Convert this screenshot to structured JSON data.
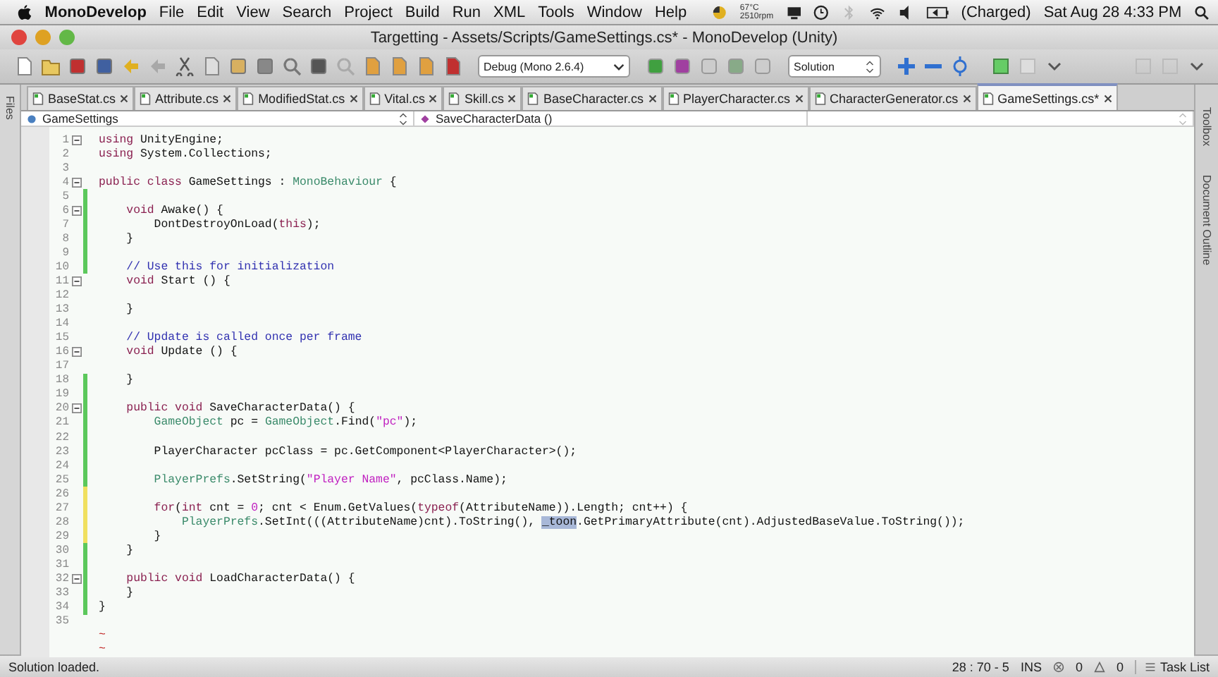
{
  "menu_bar": {
    "app": "MonoDevelop",
    "items": [
      "File",
      "Edit",
      "View",
      "Search",
      "Project",
      "Build",
      "Run",
      "XML",
      "Tools",
      "Window",
      "Help"
    ],
    "temperature": "67°C",
    "fan": "2510rpm",
    "battery": "(Charged)",
    "clock": "Sat Aug 28  4:33 PM"
  },
  "window": {
    "title": "Targetting - Assets/Scripts/GameSettings.cs* - MonoDevelop (Unity)"
  },
  "toolbar": {
    "configuration": "Debug (Mono 2.6.4)",
    "scope": "Solution"
  },
  "tabs": [
    {
      "label": "BaseStat.cs",
      "selected": false
    },
    {
      "label": "Attribute.cs",
      "selected": false
    },
    {
      "label": "ModifiedStat.cs",
      "selected": false
    },
    {
      "label": "Vital.cs",
      "selected": false
    },
    {
      "label": "Skill.cs",
      "selected": false
    },
    {
      "label": "BaseCharacter.cs",
      "selected": false
    },
    {
      "label": "PlayerCharacter.cs",
      "selected": false
    },
    {
      "label": "CharacterGenerator.cs",
      "selected": false
    },
    {
      "label": "GameSettings.cs*",
      "selected": true
    }
  ],
  "left_pad": "Files",
  "right_pads": [
    "Toolbox",
    "Document Outline"
  ],
  "navigation": {
    "type": "GameSettings",
    "member": "SaveCharacterData ()"
  },
  "code_lines": [
    {
      "number": "1",
      "fold": true,
      "tokens": [
        {
          "kind": "kw",
          "text": "using"
        },
        {
          "kind": "plain",
          "text": " UnityEngine;"
        }
      ]
    },
    {
      "number": "2",
      "fold": false,
      "tokens": [
        {
          "kind": "kw",
          "text": "using"
        },
        {
          "kind": "plain",
          "text": " System.Collections;"
        }
      ]
    },
    {
      "number": "3",
      "fold": false
    },
    {
      "number": "4",
      "fold": true,
      "tokens": [
        {
          "kind": "kw",
          "text": "public class"
        },
        {
          "kind": "plain",
          "text": " GameSettings : "
        },
        {
          "kind": "type",
          "text": "MonoBehaviour"
        },
        {
          "kind": "plain",
          "text": " {"
        }
      ]
    },
    {
      "number": "5",
      "fold": false,
      "color": "#5cc85c"
    },
    {
      "number": "6",
      "fold": true,
      "color": "#5cc85c",
      "tokens": [
        {
          "kind": "kw",
          "text": "    void"
        },
        {
          "kind": "plain",
          "text": " Awake() {"
        }
      ]
    },
    {
      "number": "7",
      "fold": false,
      "color": "#5cc85c",
      "tokens": [
        {
          "kind": "plain",
          "text": "        DontDestroyOnLoad("
        },
        {
          "kind": "kw",
          "text": "this"
        },
        {
          "kind": "plain",
          "text": ");"
        }
      ]
    },
    {
      "number": "8",
      "fold": false,
      "color": "#5cc85c",
      "tokens": [
        {
          "kind": "plain",
          "text": "    }"
        }
      ]
    },
    {
      "number": "9",
      "fold": false,
      "color": "#5cc85c"
    },
    {
      "number": "10",
      "fold": false,
      "color": "#5cc85c",
      "tokens": [
        {
          "kind": "comment",
          "text": "    // Use this for initialization"
        }
      ]
    },
    {
      "number": "11",
      "fold": true,
      "tokens": [
        {
          "kind": "kw",
          "text": "    void"
        },
        {
          "kind": "plain",
          "text": " Start () {"
        }
      ]
    },
    {
      "number": "12",
      "fold": false
    },
    {
      "number": "13",
      "fold": false,
      "tokens": [
        {
          "kind": "plain",
          "text": "    }"
        }
      ]
    },
    {
      "number": "14",
      "fold": false
    },
    {
      "number": "15",
      "fold": false,
      "tokens": [
        {
          "kind": "comment",
          "text": "    // Update is called once per frame"
        }
      ]
    },
    {
      "number": "16",
      "fold": true,
      "tokens": [
        {
          "kind": "kw",
          "text": "    void"
        },
        {
          "kind": "plain",
          "text": " Update () {"
        }
      ]
    },
    {
      "number": "17",
      "fold": false
    },
    {
      "number": "18",
      "fold": false,
      "color": "#5cc85c",
      "tokens": [
        {
          "kind": "plain",
          "text": "    }"
        }
      ]
    },
    {
      "number": "19",
      "fold": false,
      "color": "#5cc85c"
    },
    {
      "number": "20",
      "fold": true,
      "color": "#5cc85c",
      "tokens": [
        {
          "kind": "kw",
          "text": "    public void"
        },
        {
          "kind": "plain",
          "text": " SaveCharacterData() {"
        }
      ]
    },
    {
      "number": "21",
      "fold": false,
      "color": "#5cc85c",
      "tokens": [
        {
          "kind": "type",
          "text": "        GameObject"
        },
        {
          "kind": "plain",
          "text": " pc = "
        },
        {
          "kind": "type",
          "text": "GameObject"
        },
        {
          "kind": "plain",
          "text": ".Find("
        },
        {
          "kind": "str",
          "text": "\"pc\""
        },
        {
          "kind": "plain",
          "text": ");"
        }
      ]
    },
    {
      "number": "22",
      "fold": false,
      "color": "#5cc85c"
    },
    {
      "number": "23",
      "fold": false,
      "color": "#5cc85c",
      "tokens": [
        {
          "kind": "plain",
          "text": "        PlayerCharacter pcClass = pc.GetComponent<PlayerCharacter>();"
        }
      ]
    },
    {
      "number": "24",
      "fold": false,
      "color": "#5cc85c"
    },
    {
      "number": "25",
      "fold": false,
      "color": "#5cc85c",
      "tokens": [
        {
          "kind": "type",
          "text": "        PlayerPrefs"
        },
        {
          "kind": "plain",
          "text": ".SetString("
        },
        {
          "kind": "str",
          "text": "\"Player Name\""
        },
        {
          "kind": "plain",
          "text": ", pcClass.Name);"
        }
      ]
    },
    {
      "number": "26",
      "fold": false,
      "color": "#f0e060"
    },
    {
      "number": "27",
      "fold": false,
      "color": "#f0e060",
      "tokens": [
        {
          "kind": "kw",
          "text": "        for"
        },
        {
          "kind": "plain",
          "text": "("
        },
        {
          "kind": "kw",
          "text": "int"
        },
        {
          "kind": "plain",
          "text": " cnt = "
        },
        {
          "kind": "str",
          "text": "0"
        },
        {
          "kind": "plain",
          "text": "; cnt < Enum.GetValues("
        },
        {
          "kind": "kw",
          "text": "typeof"
        },
        {
          "kind": "plain",
          "text": "(AttributeName)).Length; cnt++) {"
        }
      ]
    },
    {
      "number": "28",
      "fold": false,
      "color": "#f0e060",
      "tokens": [
        {
          "kind": "type",
          "text": "            PlayerPrefs"
        },
        {
          "kind": "plain",
          "text": ".SetInt(((AttributeName)cnt).ToString(), "
        },
        {
          "kind": "sel",
          "text": "_toon"
        },
        {
          "kind": "plain",
          "text": ".GetPrimaryAttribute(cnt).AdjustedBaseValue.ToString());"
        }
      ]
    },
    {
      "number": "29",
      "fold": false,
      "color": "#f0e060",
      "tokens": [
        {
          "kind": "plain",
          "text": "        }"
        }
      ]
    },
    {
      "number": "30",
      "fold": false,
      "color": "#5cc85c",
      "tokens": [
        {
          "kind": "plain",
          "text": "    }"
        }
      ]
    },
    {
      "number": "31",
      "fold": false,
      "color": "#5cc85c"
    },
    {
      "number": "32",
      "fold": true,
      "color": "#5cc85c",
      "tokens": [
        {
          "kind": "kw",
          "text": "    public void"
        },
        {
          "kind": "plain",
          "text": " LoadCharacterData() {"
        }
      ]
    },
    {
      "number": "33",
      "fold": false,
      "color": "#5cc85c",
      "tokens": [
        {
          "kind": "plain",
          "text": "    }"
        }
      ]
    },
    {
      "number": "34",
      "fold": false,
      "color": "#5cc85c",
      "tokens": [
        {
          "kind": "plain",
          "text": "}"
        }
      ]
    },
    {
      "number": "35",
      "fold": false
    }
  ],
  "end_markers": [
    "~",
    "~"
  ],
  "status_bar": {
    "message": "Solution loaded.",
    "position": "28 : 70 - 5",
    "mode": "INS",
    "errors": "0",
    "warnings": "0",
    "task_list": "Task List"
  }
}
